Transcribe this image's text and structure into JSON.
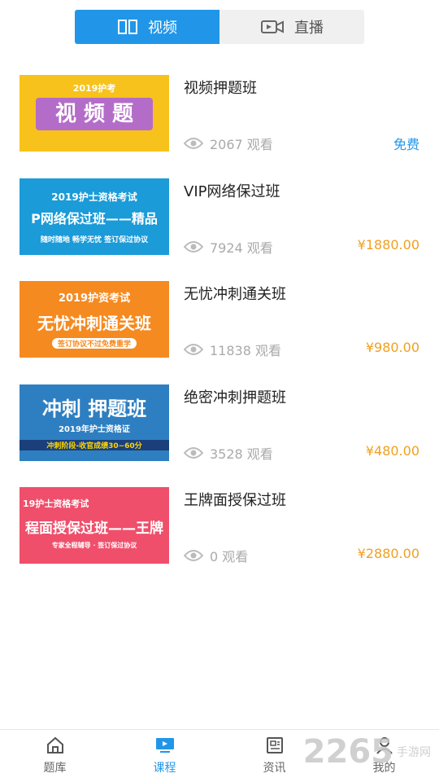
{
  "tabs": [
    {
      "label": "视频",
      "icon": "book-icon",
      "active": true
    },
    {
      "label": "直播",
      "icon": "video-camera-icon",
      "active": false
    }
  ],
  "courses": [
    {
      "title": "视频押题班",
      "views": "2067 观看",
      "price": "免费",
      "free": true,
      "thumb": {
        "bg": "#f7c21b",
        "line1": "2019护考",
        "line2": "视 频 题",
        "line3": ""
      }
    },
    {
      "title": "VIP网络保过班",
      "views": "7924 观看",
      "price": "¥1880.00",
      "free": false,
      "thumb": {
        "bg": "#1b9bd8",
        "line1": "2019护士资格考试",
        "line2": "P网络保过班——精品",
        "line3": "随时随地   畅学无忧   签订保过协议"
      }
    },
    {
      "title": "无忧冲刺通关班",
      "views": "11838 观看",
      "price": "¥980.00",
      "free": false,
      "thumb": {
        "bg": "#f58a20",
        "line1": "2019护资考试",
        "line2": "无忧冲刺通关班",
        "line3": "签订协议不过免费重学"
      }
    },
    {
      "title": "绝密冲刺押题班",
      "views": "3528 观看",
      "price": "¥480.00",
      "free": false,
      "thumb": {
        "bg": "#2e7fc1",
        "line1": "冲刺 押题班",
        "line2": "2019年护士资格证",
        "line3": "冲刺阶段-收官成绩30~60分"
      }
    },
    {
      "title": "王牌面授保过班",
      "views": "0 观看",
      "price": "¥2880.00",
      "free": false,
      "thumb": {
        "bg": "#ef4f6b",
        "line1": "19护士资格考试",
        "line2": "程面授保过班——王牌",
        "line3": "专家全程辅导 · 签订保过协议"
      }
    }
  ],
  "bottom_nav": [
    {
      "label": "题库",
      "icon": "home-icon",
      "active": false
    },
    {
      "label": "课程",
      "icon": "monitor-icon",
      "active": true
    },
    {
      "label": "资讯",
      "icon": "news-icon",
      "active": false
    },
    {
      "label": "我的",
      "icon": "user-icon",
      "active": false
    }
  ],
  "watermark": {
    "text": "2265",
    "sub": "手游网"
  },
  "colors": {
    "accent": "#2196e8",
    "price": "#f0a020"
  }
}
